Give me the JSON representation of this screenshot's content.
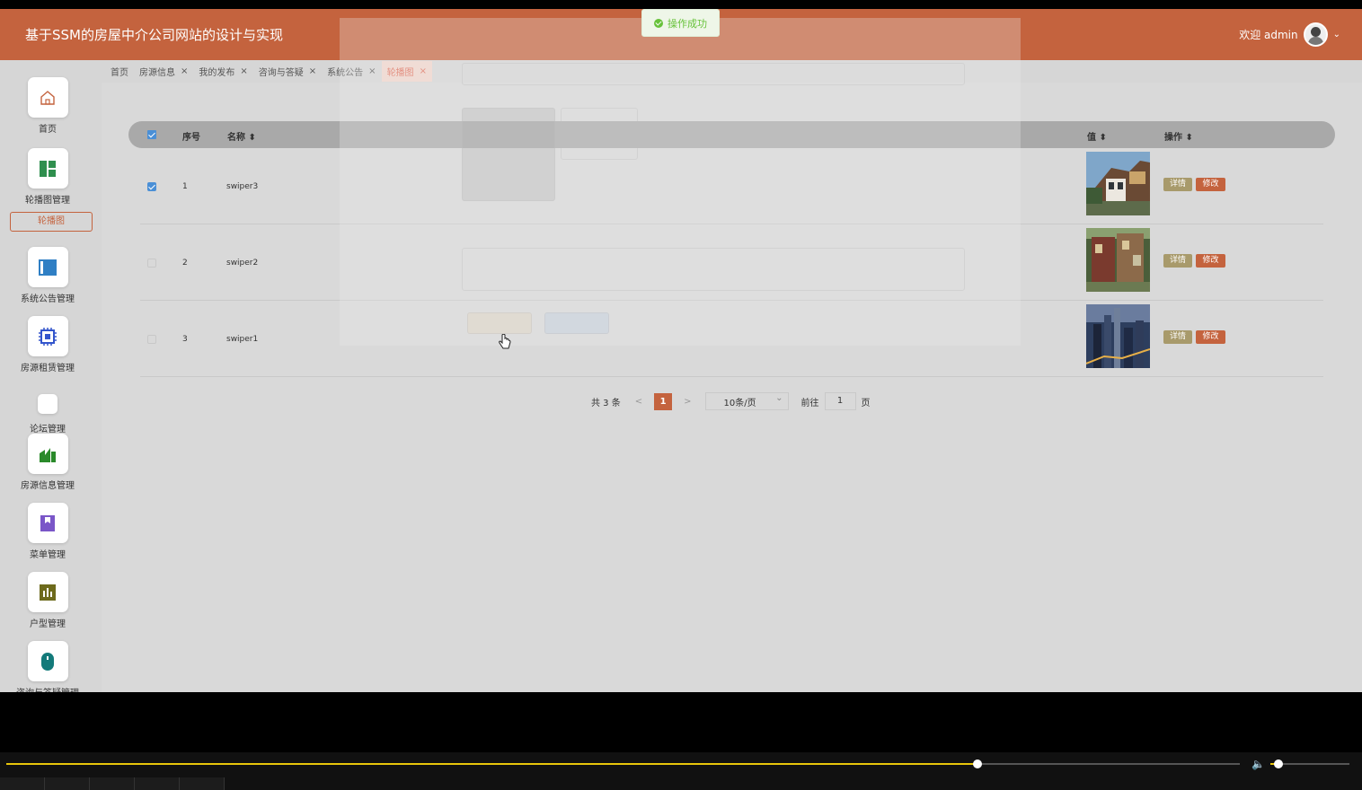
{
  "header": {
    "title": "基于SSM的房屋中介公司网站的设计与实现",
    "welcome": "欢迎 admin",
    "dropdown_glyph": "⌄"
  },
  "toast": {
    "message": "操作成功"
  },
  "sidebar": {
    "items": [
      {
        "label": "首页",
        "icon": "home-icon",
        "color": "#c4633e"
      },
      {
        "label": "轮播图管理",
        "icon": "grid-icon",
        "color": "#2f8f4e"
      },
      {
        "label": "系统公告管理",
        "icon": "panel-icon",
        "color": "#2f7fc4"
      },
      {
        "label": "房源租赁管理",
        "icon": "chip-icon",
        "color": "#3355cc"
      },
      {
        "label": "论坛管理",
        "icon": "blank-icon",
        "color": "#ffffff"
      },
      {
        "label": "房源信息管理",
        "icon": "chart-icon",
        "color": "#2a8a2a"
      },
      {
        "label": "菜单管理",
        "icon": "bookmark-icon",
        "color": "#7a56c8"
      },
      {
        "label": "户型管理",
        "icon": "bars-icon",
        "color": "#6d6a1c"
      },
      {
        "label": "咨询与答疑管理",
        "icon": "mouse-icon",
        "color": "#137a7a"
      }
    ],
    "sub_item": "轮播图"
  },
  "tabs": [
    {
      "label": "首页",
      "closable": false,
      "active": false
    },
    {
      "label": "房源信息",
      "closable": true,
      "active": false
    },
    {
      "label": "我的发布",
      "closable": true,
      "active": false
    },
    {
      "label": "咨询与答疑",
      "closable": true,
      "active": false
    },
    {
      "label": "系统公告",
      "closable": true,
      "active": false
    },
    {
      "label": "轮播图",
      "closable": true,
      "active": true
    }
  ],
  "tab_close_glyph": "×",
  "table": {
    "columns": {
      "index": "序号",
      "name": "名称",
      "value": "值",
      "action": "操作"
    },
    "sort_glyph": "⬍",
    "rows": [
      {
        "index": "1",
        "name": "swiper3",
        "checked": true,
        "thumb": "building"
      },
      {
        "index": "2",
        "name": "swiper2",
        "checked": false,
        "thumb": "street"
      },
      {
        "index": "3",
        "name": "swiper1",
        "checked": false,
        "thumb": "city"
      }
    ],
    "detail_label": "详情",
    "edit_label": "修改"
  },
  "pagination": {
    "total": "共 3 条",
    "prev": "<",
    "current": "1",
    "next": ">",
    "page_size": "10条/页",
    "goto_label": "前往",
    "goto_value": "1",
    "page_suffix": "页"
  },
  "player": {
    "progress": 0.787,
    "volume": 0.1,
    "volume_glyph": "🔈"
  }
}
